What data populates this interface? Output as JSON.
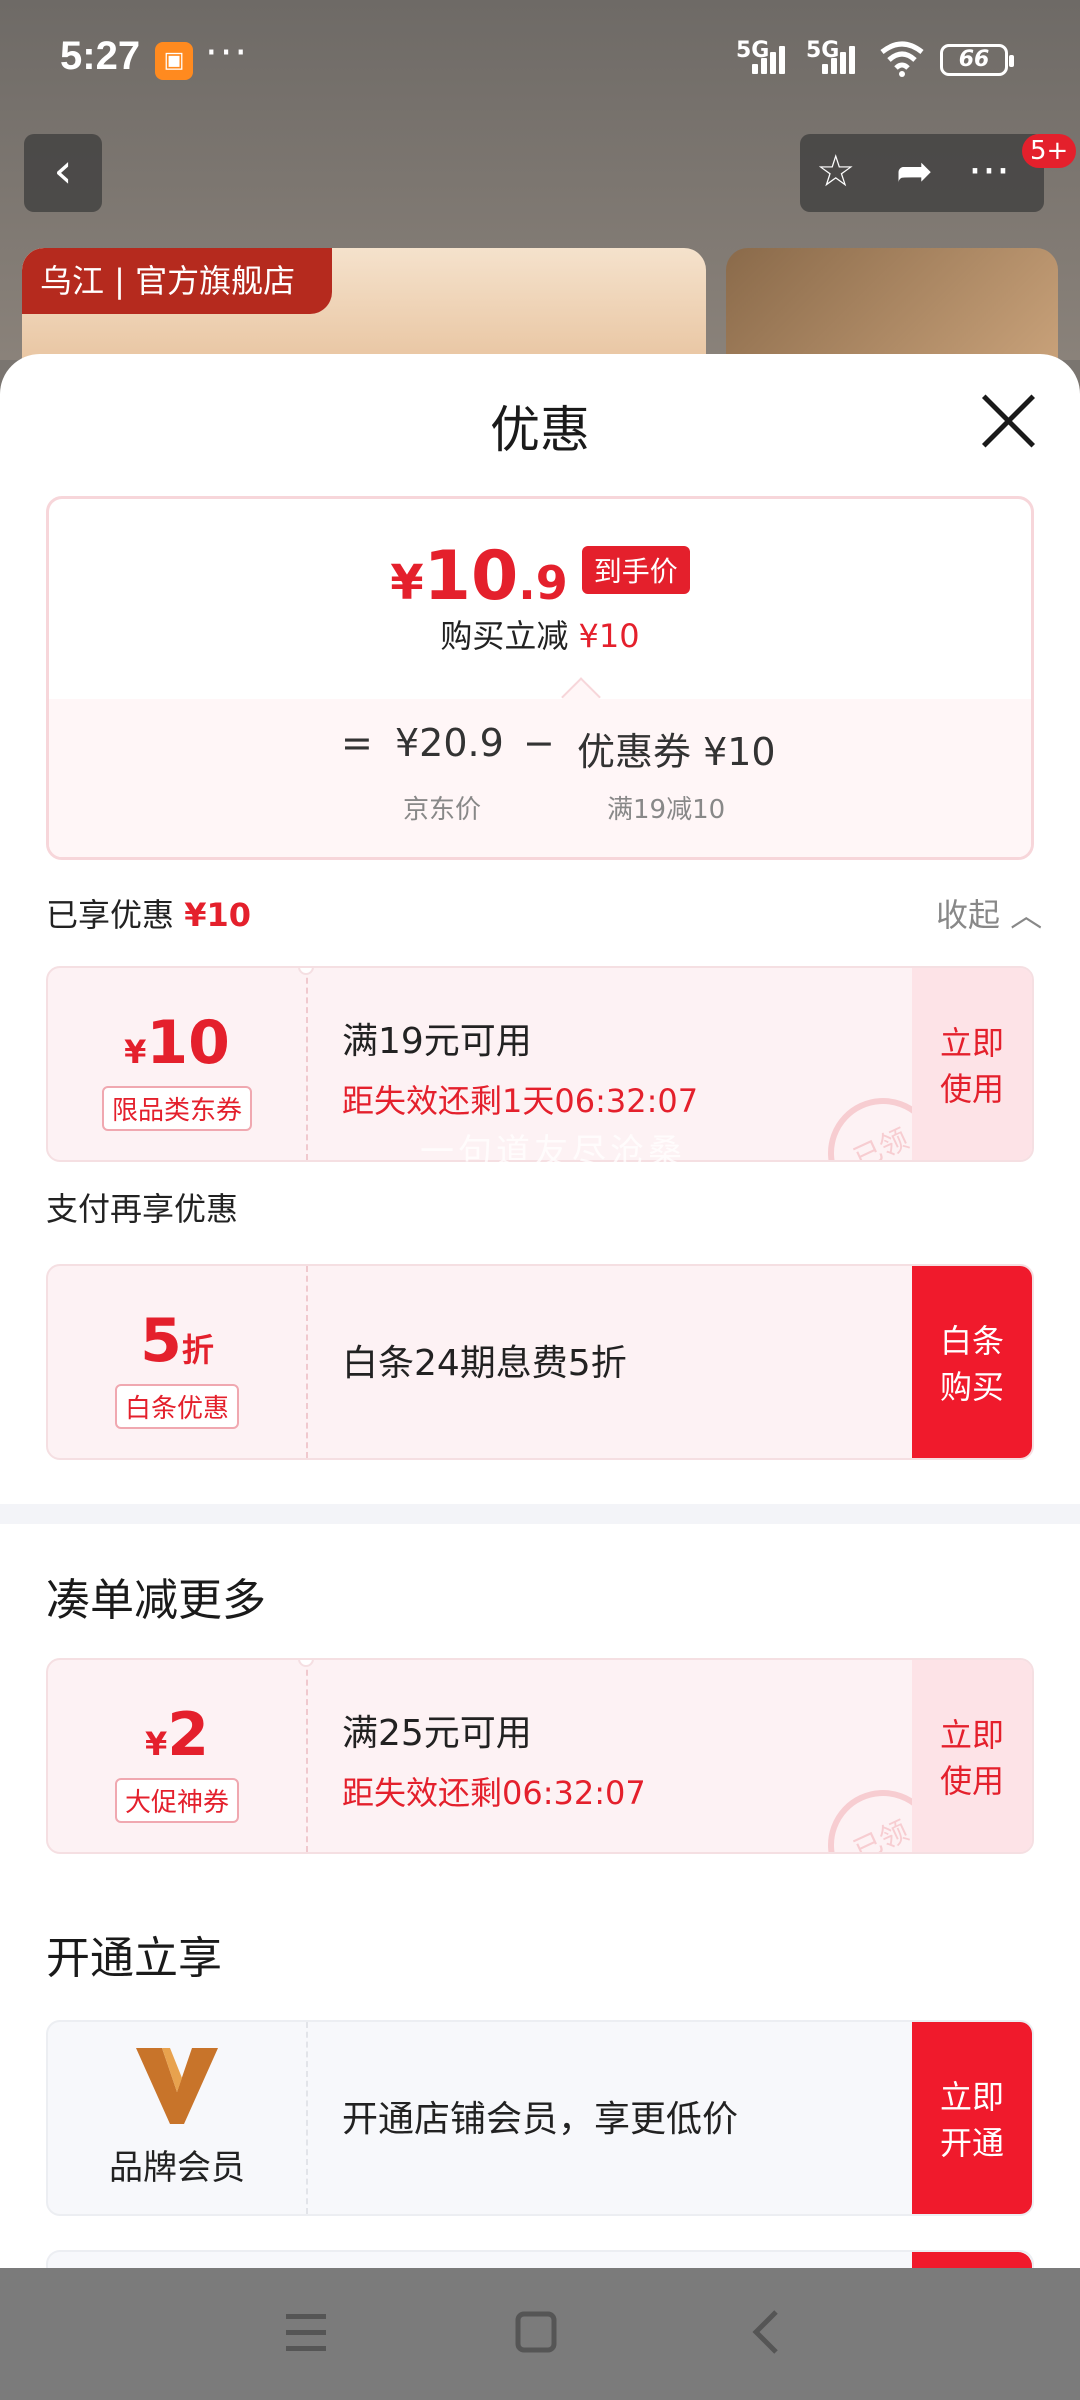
{
  "status": {
    "time": "5:27",
    "signal1": "5G",
    "signal2": "5G",
    "battery": "66"
  },
  "header": {
    "more_badge": "5+"
  },
  "shop": {
    "banner_label": "乌江 | 官方旗舰店"
  },
  "sheet": {
    "title": "优惠"
  },
  "price": {
    "yen": "¥",
    "integer": "10",
    "decimal": ".9",
    "tag": "到手价",
    "sub_prefix": "购买立减",
    "sub_amount": "¥10",
    "eq": "=",
    "base": "¥20.9",
    "minus": "−",
    "coupon": "优惠券 ¥10",
    "base_label": "京东价",
    "coupon_label": "满19减10"
  },
  "enjoyed": {
    "label": "已享优惠",
    "amount": "¥10",
    "collapse": "收起"
  },
  "coupon1": {
    "yen": "¥",
    "amount": "10",
    "tag": "限品类东券",
    "title": "满19元可用",
    "expire": "距失效还剩1天06:32:07",
    "action_line1": "立即",
    "action_line2": "使用",
    "stamp": "已领"
  },
  "watermark": "一句道友尽沧桑",
  "pay": {
    "label": "支付再享优惠"
  },
  "coupon2": {
    "amount": "5",
    "unit": "折",
    "tag": "白条优惠",
    "title": "白条24期息费5折",
    "action_line1": "白条",
    "action_line2": "购买"
  },
  "more": {
    "title": "凑单减更多"
  },
  "coupon3": {
    "yen": "¥",
    "amount": "2",
    "tag": "大促神券",
    "title": "满25元可用",
    "expire": "距失效还剩06:32:07",
    "action_line1": "立即",
    "action_line2": "使用",
    "stamp": "已领"
  },
  "open": {
    "title": "开通立享"
  },
  "member": {
    "name": "品牌会员",
    "text": "开通店铺会员，享更低价",
    "action_line1": "立即",
    "action_line2": "开通"
  },
  "colors": {
    "accent": "#e4202c",
    "action_solid": "#f01a2c"
  }
}
